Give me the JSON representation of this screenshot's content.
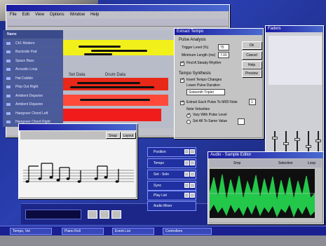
{
  "main_window": {
    "title": "",
    "menu": [
      "File",
      "Edit",
      "View",
      "Options",
      "Window",
      "Help"
    ]
  },
  "tracks": {
    "header": "Name",
    "items": [
      "Ch1 Modern",
      "Backside Pad",
      "Space Bass",
      "Acoustic Loop",
      "Hat Dubble",
      "Plop Out Right",
      "Ambient Dejavion",
      "Ambient Dejavion",
      "Hangover Chord Left",
      "Hangover Chord Right"
    ]
  },
  "note_area": {
    "left_label": "Set Data",
    "right_label": "Drum Data"
  },
  "dialog": {
    "title": "Extract Tempo",
    "section_pulse": "Pulse Analysis",
    "trigger_label": "Trigger Level (%)",
    "trigger_value": "75",
    "min_length_label": "Minimum Length (ms)",
    "min_length_value": "7.00",
    "check_steady": "Find A Steady Rhythm",
    "section_tempo": "Tempo Synthesis",
    "insert_tempo": "Insert Tempo Changes",
    "lower_pulse_label": "Lower Pulse Duration",
    "lower_pulse_value": "Sixteenth Triplet",
    "extract_each": "Extract Each Pulse To MIDI Note",
    "extract_value": "1",
    "note_velocities": "Note Velocities",
    "vary_with_pulse": "Vary With Pulse Level",
    "set_all_same": "Set All To Same Value",
    "ok": "Ok",
    "cancel": "Cancel",
    "help": "Help",
    "preview": "Preview"
  },
  "mixer": {
    "title": "Faders"
  },
  "score": {
    "title": "",
    "buttons": [
      "Snap",
      "Layout"
    ]
  },
  "panels": [
    "Position",
    "Tempo",
    "Set - Solo",
    "Sync",
    "Play List",
    "Audio Mixer"
  ],
  "sample_editor": {
    "title": "Audio - Sample Editor",
    "tab_left": "Smp",
    "tab_right": "Selection",
    "tab_far": "Loop"
  },
  "taskbar": {
    "items": [
      "Tempo, Vel",
      "Piano Roll",
      "Event List",
      "Controllers"
    ]
  },
  "colors": {
    "desktop": "#1b2b8a",
    "title_bar": "#1a1aa0",
    "yellow_band": "#f2f01a",
    "red_band": "#e82818",
    "wave_green": "#23c84a"
  }
}
